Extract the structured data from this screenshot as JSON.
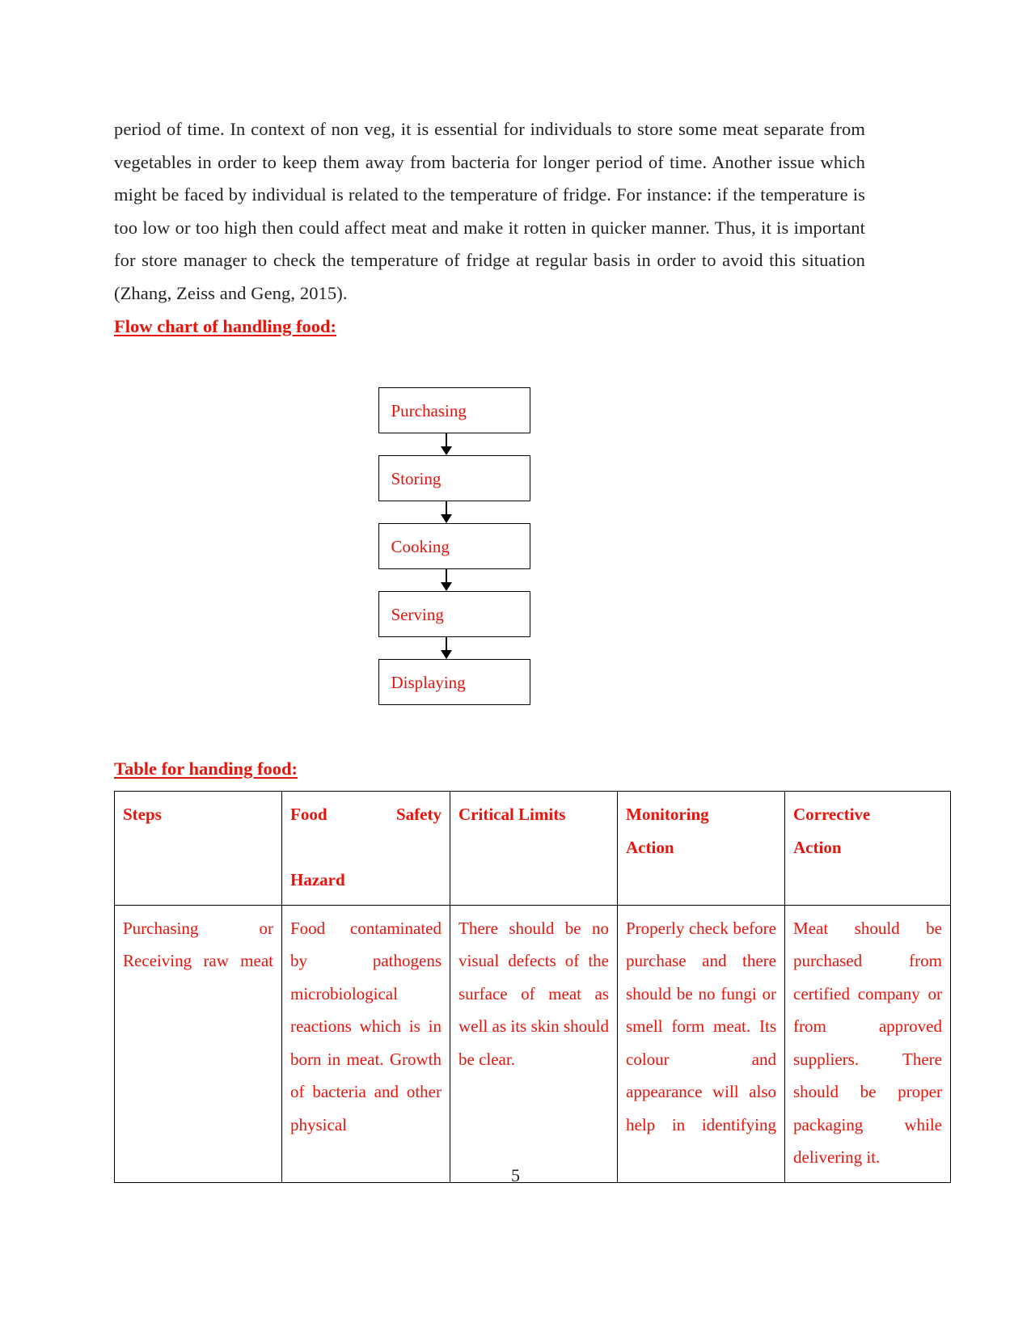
{
  "document": {
    "page_number": "5",
    "accent_color": "#e8140c",
    "text_color": "#231f20",
    "paragraph": "period of time. In context of non veg, it is essential for individuals to store some meat separate from vegetables in order to keep them away from bacteria for longer period of time. Another issue which might be faced by individual is related to the temperature of fridge. For instance: if the temperature is too low or too high then could affect meat and make it rotten in quicker manner. Thus, it is important for  store manager to check the temperature of fridge at regular basis in order to avoid this situation (Zhang, Zeiss and Geng, 2015)."
  },
  "flowchart": {
    "heading": "Flow chart of handling food:",
    "steps": [
      {
        "label": "Purchasing"
      },
      {
        "label": "Storing"
      },
      {
        "label": "Cooking"
      },
      {
        "label": "Serving"
      },
      {
        "label": "Displaying"
      }
    ]
  },
  "table": {
    "heading": "Table for handing food:",
    "columns": [
      {
        "line1": "Steps",
        "line2": ""
      },
      {
        "line1": "Food       Safety",
        "line2": "Hazard"
      },
      {
        "line1": "Critical Limits",
        "line2": ""
      },
      {
        "line1": "Monitoring",
        "line2": "Action"
      },
      {
        "line1": "Corrective",
        "line2": "Action"
      }
    ],
    "rows": [
      {
        "steps": "Purchasing or Receiving raw meat",
        "hazard": "Food contaminated by pathogens microbiological reactions which is in born in meat. Growth of bacteria and other physical",
        "limits": "There should be no visual defects of the surface of meat as well as its skin should be clear.",
        "monitoring": "Properly check before purchase and there should be no fungi or smell form meat. Its colour and appearance will also help in identifying",
        "corrective": "Meat should be purchased from certified company or from approved suppliers. There should be proper packaging while delivering it."
      }
    ]
  }
}
